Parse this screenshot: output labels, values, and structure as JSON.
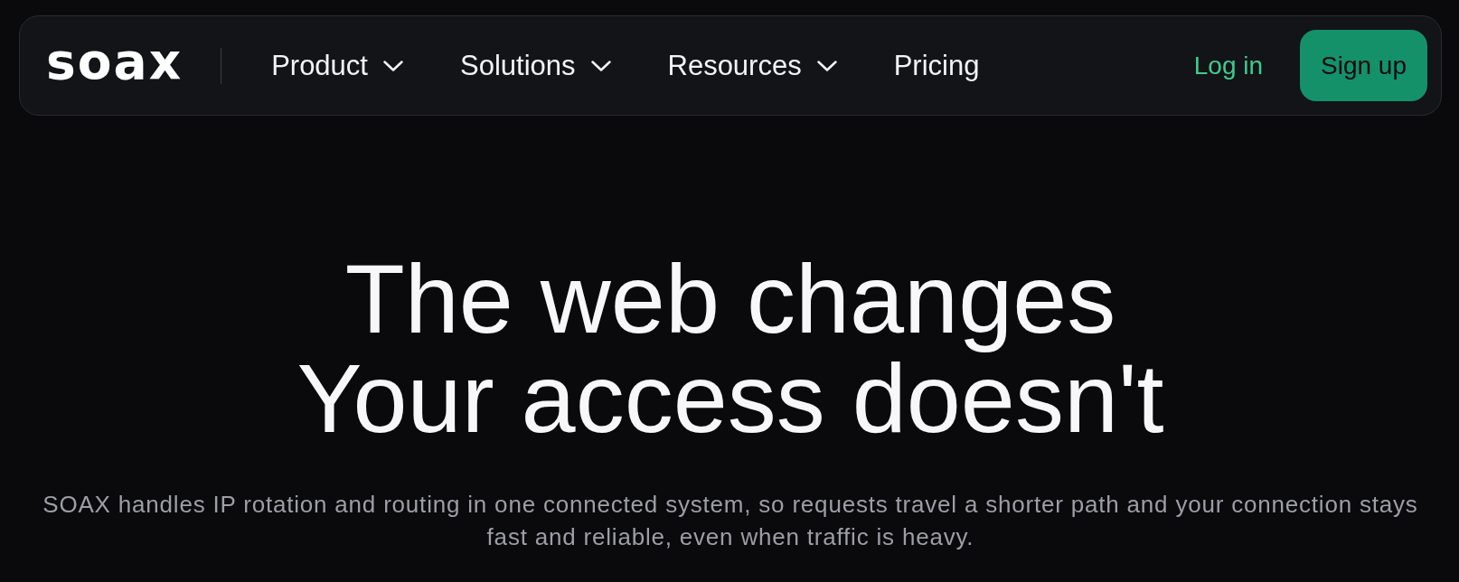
{
  "nav": {
    "logo": "soax",
    "items": [
      {
        "label": "Product",
        "kind": "dropdown"
      },
      {
        "label": "Solutions",
        "kind": "dropdown"
      },
      {
        "label": "Resources",
        "kind": "dropdown"
      },
      {
        "label": "Pricing",
        "kind": "link"
      }
    ],
    "login": "Log in",
    "signup": "Sign up"
  },
  "hero": {
    "title_lines": [
      "The web changes",
      "Your access doesn't"
    ],
    "subtitle": "SOAX handles IP rotation and routing in one connected system, so requests travel a shorter path and your connection stays fast and reliable, even when traffic is heavy."
  }
}
